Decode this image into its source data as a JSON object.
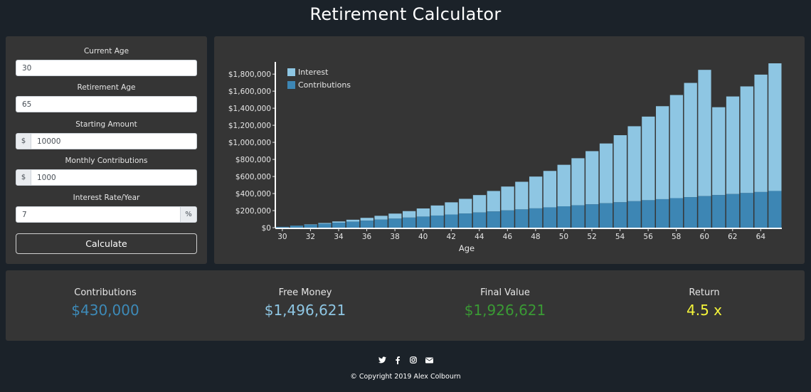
{
  "app": {
    "title": "Retirement Calculator"
  },
  "form": {
    "current_age": {
      "label": "Current Age",
      "value": "30"
    },
    "retirement_age": {
      "label": "Retirement Age",
      "value": "65"
    },
    "starting_amount": {
      "label": "Starting Amount",
      "prefix": "$",
      "value": "10000"
    },
    "monthly_contributions": {
      "label": "Monthly Contributions",
      "prefix": "$",
      "value": "1000"
    },
    "interest_rate": {
      "label": "Interest Rate/Year",
      "value": "7",
      "suffix": "%"
    },
    "calculate_label": "Calculate"
  },
  "stats": {
    "contributions": {
      "label": "Contributions",
      "value": "$430,000",
      "color": "#3d8ab8"
    },
    "free_money": {
      "label": "Free Money",
      "value": "$1,496,621",
      "color": "#8ec6e3"
    },
    "final_value": {
      "label": "Final Value",
      "value": "$1,926,621",
      "color": "#3a9a34"
    },
    "return": {
      "label": "Return",
      "value": "4.5 x",
      "color": "#f5f53a"
    }
  },
  "footer": {
    "icons": [
      "twitter-icon",
      "facebook-icon",
      "instagram-icon",
      "email-icon"
    ],
    "copyright": "© Copyright 2019 Alex Colbourn"
  },
  "chart_data": {
    "type": "bar",
    "stacked": true,
    "xlabel": "Age",
    "ylabel": "",
    "ylim": [
      0,
      1926621
    ],
    "y_ticks": [
      0,
      200000,
      400000,
      600000,
      800000,
      1000000,
      1200000,
      1400000,
      1600000,
      1800000
    ],
    "y_tick_labels": [
      "$0",
      "$200,000",
      "$400,000",
      "$600,000",
      "$800,000",
      "$1,000,000",
      "$1,200,000",
      "$1,400,000",
      "$1,600,000",
      "$1,800,000"
    ],
    "x_tick_labels": [
      "30",
      "32",
      "34",
      "36",
      "38",
      "40",
      "42",
      "44",
      "46",
      "48",
      "50",
      "52",
      "54",
      "56",
      "58",
      "60",
      "62",
      "64"
    ],
    "legend": "top-left",
    "colors": {
      "interest": "#8ec6e3",
      "contributions": "#3d86b4"
    },
    "categories": [
      30,
      31,
      32,
      33,
      34,
      35,
      36,
      37,
      38,
      39,
      40,
      41,
      42,
      43,
      44,
      45,
      46,
      47,
      48,
      49,
      50,
      51,
      52,
      53,
      54,
      55,
      56,
      57,
      58,
      59,
      60,
      61,
      62,
      63,
      64,
      65
    ],
    "series": [
      {
        "name": "Contributions",
        "values": [
          10000,
          22000,
          34000,
          46000,
          58000,
          70000,
          82000,
          94000,
          106000,
          118000,
          130000,
          142000,
          154000,
          166000,
          178000,
          190000,
          202000,
          214000,
          226000,
          238000,
          250000,
          262000,
          274000,
          286000,
          298000,
          310000,
          322000,
          334000,
          346000,
          358000,
          370000,
          382000,
          394000,
          406000,
          418000,
          430000
        ]
      },
      {
        "name": "Interest",
        "values": [
          0,
          1700,
          4500,
          9000,
          15000,
          23000,
          33000,
          45000,
          59000,
          76000,
          95000,
          118000,
          143000,
          172000,
          204000,
          240000,
          280000,
          324000,
          373000,
          427000,
          487000,
          552000,
          623000,
          701000,
          786000,
          879000,
          980000,
          1090000,
          1209000,
          1339000,
          1480000,
          1030000,
          1144000,
          1250000,
          1376000,
          1496621
        ]
      }
    ]
  }
}
